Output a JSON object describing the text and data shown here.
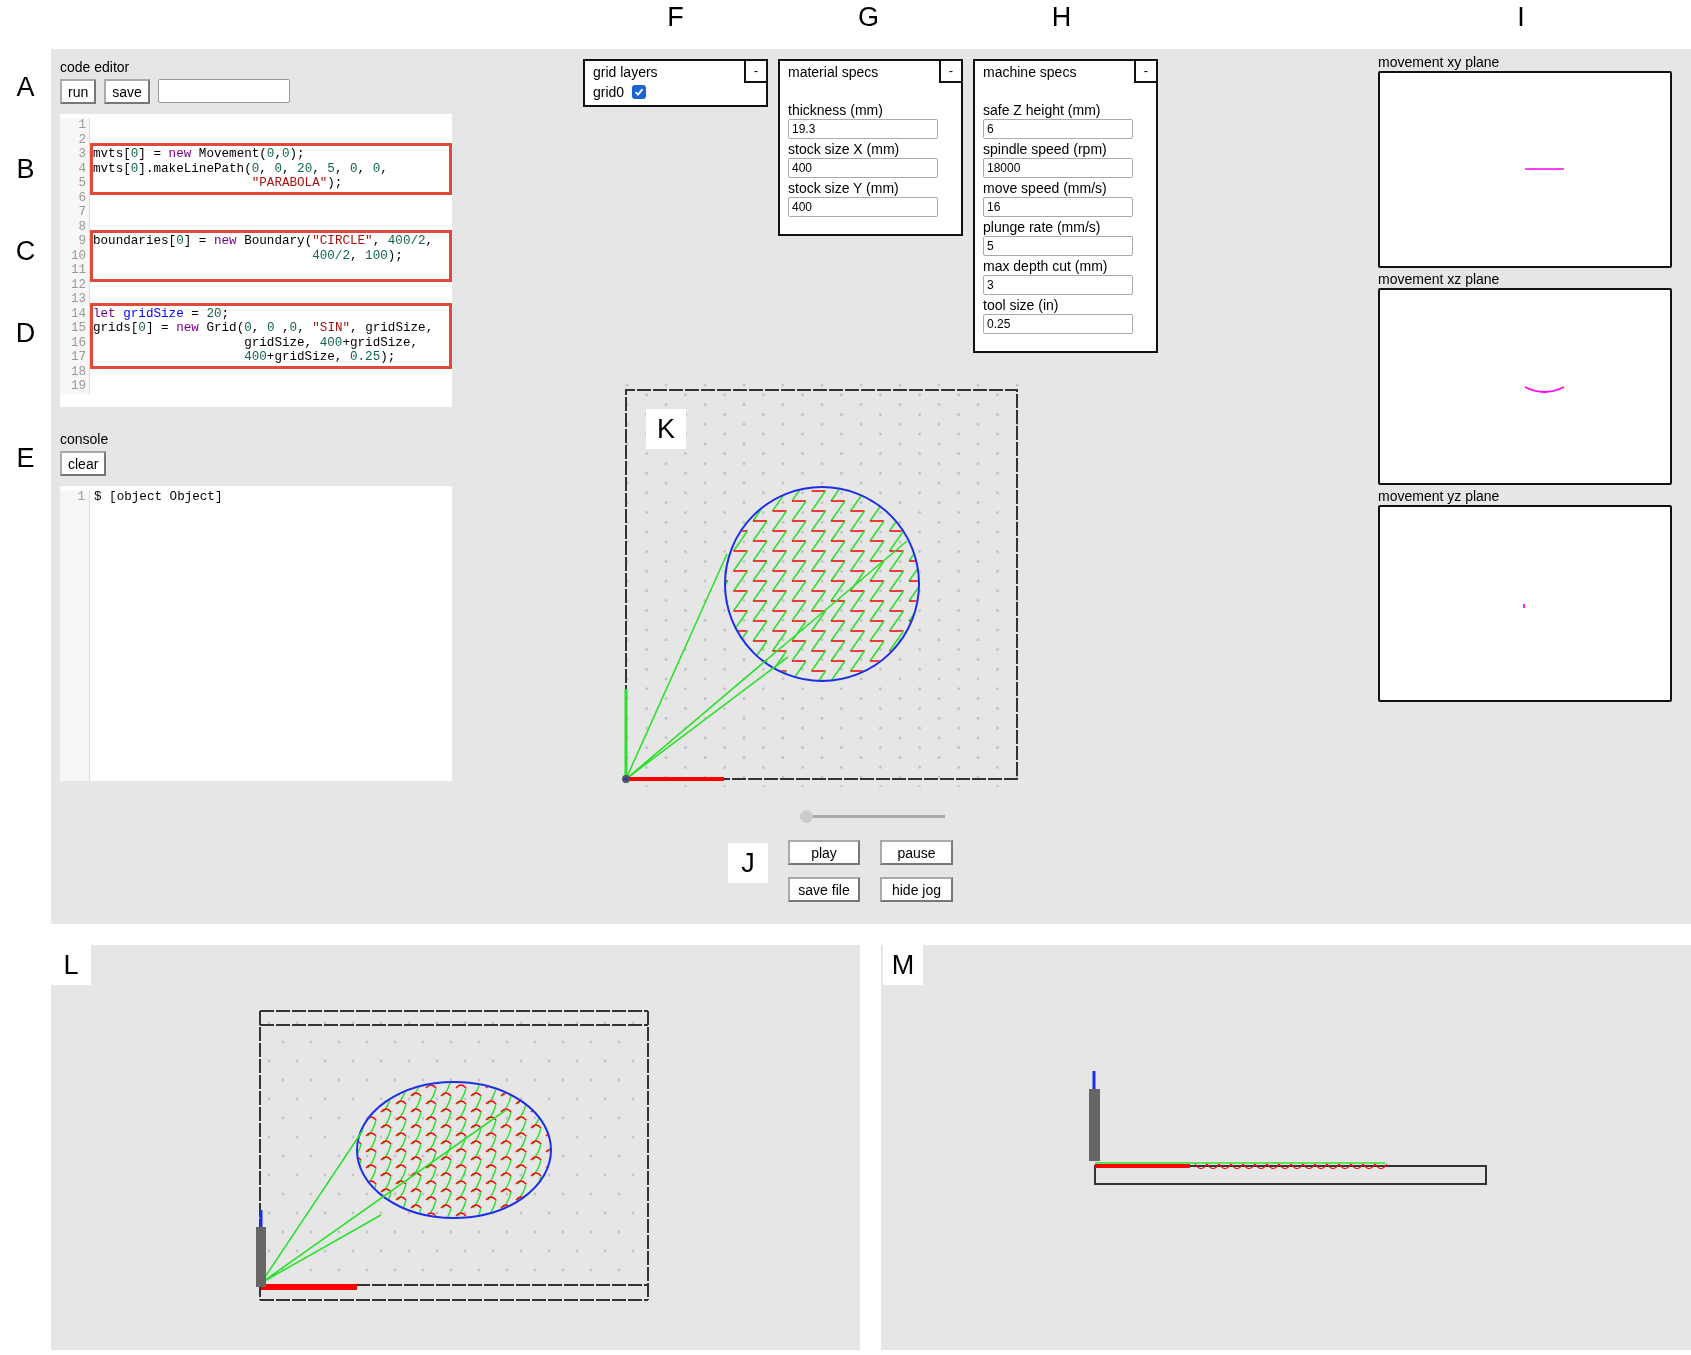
{
  "code_editor": {
    "marker": "A",
    "title": "code editor",
    "buttons": [
      "run",
      "save"
    ],
    "segments": [
      {
        "kind": "plain",
        "lines": [
          {
            "number": "1"
          },
          {
            "number": "2"
          }
        ]
      },
      {
        "kind": "highlight",
        "marker": "B",
        "lines": [
          {
            "number": "3",
            "tokens": [
              {
                "text": "mvts[",
                "kind": "plain"
              },
              {
                "text": "0",
                "kind": "number"
              },
              {
                "text": "] = ",
                "kind": "plain"
              },
              {
                "text": "new",
                "kind": "keyword"
              },
              {
                "text": " Movement(",
                "kind": "plain"
              },
              {
                "text": "0",
                "kind": "number"
              },
              {
                "text": ",",
                "kind": "plain"
              },
              {
                "text": "0",
                "kind": "number"
              },
              {
                "text": ");",
                "kind": "plain"
              }
            ]
          },
          {
            "number": "4",
            "tokens": [
              {
                "text": "mvts[",
                "kind": "plain"
              },
              {
                "text": "0",
                "kind": "number"
              },
              {
                "text": "].makeLinePath(",
                "kind": "plain"
              },
              {
                "text": "0",
                "kind": "number"
              },
              {
                "text": ", ",
                "kind": "plain"
              },
              {
                "text": "0",
                "kind": "number"
              },
              {
                "text": ", ",
                "kind": "plain"
              },
              {
                "text": "20",
                "kind": "number"
              },
              {
                "text": ", ",
                "kind": "plain"
              },
              {
                "text": "5",
                "kind": "number"
              },
              {
                "text": ", ",
                "kind": "plain"
              },
              {
                "text": "0",
                "kind": "number"
              },
              {
                "text": ", ",
                "kind": "plain"
              },
              {
                "text": "0",
                "kind": "number"
              },
              {
                "text": ",",
                "kind": "plain"
              }
            ]
          },
          {
            "number": "5",
            "tokens": [
              {
                "text": "                     \"PARABOLA\"",
                "kind": "string"
              },
              {
                "text": ");",
                "kind": "plain"
              }
            ]
          }
        ]
      },
      {
        "kind": "plain",
        "lines": [
          {
            "number": "6"
          },
          {
            "number": "7"
          },
          {
            "number": "8"
          }
        ]
      },
      {
        "kind": "highlight",
        "marker": "C",
        "lines": [
          {
            "number": "9",
            "tokens": [
              {
                "text": "boundaries[",
                "kind": "plain"
              },
              {
                "text": "0",
                "kind": "number"
              },
              {
                "text": "] = ",
                "kind": "plain"
              },
              {
                "text": "new",
                "kind": "keyword"
              },
              {
                "text": " Boundary(",
                "kind": "plain"
              },
              {
                "text": "\"CIRCLE\"",
                "kind": "string"
              },
              {
                "text": ", ",
                "kind": "plain"
              },
              {
                "text": "400/2",
                "kind": "number"
              },
              {
                "text": ",",
                "kind": "plain"
              }
            ]
          },
          {
            "number": "10",
            "tokens": [
              {
                "text": "                             400/2",
                "kind": "number"
              },
              {
                "text": ", ",
                "kind": "plain"
              },
              {
                "text": "100",
                "kind": "number"
              },
              {
                "text": ");",
                "kind": "plain"
              }
            ]
          },
          {
            "number": "11"
          }
        ]
      },
      {
        "kind": "plain",
        "lines": [
          {
            "number": "12"
          },
          {
            "number": "13"
          }
        ]
      },
      {
        "kind": "highlight",
        "marker": "D",
        "lines": [
          {
            "number": "14",
            "tokens": [
              {
                "text": "let",
                "kind": "keyword"
              },
              {
                "text": " gridSize",
                "kind": "def"
              },
              {
                "text": " = ",
                "kind": "plain"
              },
              {
                "text": "20",
                "kind": "number"
              },
              {
                "text": ";",
                "kind": "plain"
              }
            ]
          },
          {
            "number": "15",
            "tokens": [
              {
                "text": "grids[",
                "kind": "plain"
              },
              {
                "text": "0",
                "kind": "number"
              },
              {
                "text": "] = ",
                "kind": "plain"
              },
              {
                "text": "new",
                "kind": "keyword"
              },
              {
                "text": " Grid(",
                "kind": "plain"
              },
              {
                "text": "0",
                "kind": "number"
              },
              {
                "text": ", ",
                "kind": "plain"
              },
              {
                "text": "0",
                "kind": "number"
              },
              {
                "text": " ,",
                "kind": "plain"
              },
              {
                "text": "0",
                "kind": "number"
              },
              {
                "text": ", ",
                "kind": "plain"
              },
              {
                "text": "\"SIN\"",
                "kind": "string"
              },
              {
                "text": ", gridSize,",
                "kind": "plain"
              }
            ]
          },
          {
            "number": "16",
            "tokens": [
              {
                "text": "                    gridSize, ",
                "kind": "plain"
              },
              {
                "text": "400",
                "kind": "number"
              },
              {
                "text": "+gridSize,",
                "kind": "plain"
              }
            ]
          },
          {
            "number": "17",
            "tokens": [
              {
                "text": "                    400",
                "kind": "number"
              },
              {
                "text": "+gridSize, ",
                "kind": "plain"
              },
              {
                "text": "0.25",
                "kind": "number"
              },
              {
                "text": ");",
                "kind": "plain"
              }
            ]
          }
        ]
      },
      {
        "kind": "plain",
        "lines": [
          {
            "number": "18"
          },
          {
            "number": "19"
          }
        ]
      }
    ]
  },
  "console": {
    "marker": "E",
    "title": "console",
    "buttons": [
      "clear"
    ],
    "lines": [
      {
        "number": "1",
        "text": "$ [object Object]"
      }
    ]
  },
  "grid_layers": {
    "marker": "F",
    "title": "grid layers",
    "collapse_button": "-",
    "layers": [
      {
        "label": "grid0",
        "checked": true
      }
    ]
  },
  "material_specs": {
    "marker": "G",
    "title": "material specs",
    "collapse_button": "-",
    "fields": [
      {
        "label": "thickness (mm)",
        "value": "19.3"
      },
      {
        "label": "stock size X (mm)",
        "value": "400"
      },
      {
        "label": "stock size Y (mm)",
        "value": "400"
      }
    ]
  },
  "machine_specs": {
    "marker": "H",
    "title": "machine specs",
    "collapse_button": "-",
    "fields": [
      {
        "label": "safe Z height (mm)",
        "value": "6"
      },
      {
        "label": "spindle speed (rpm)",
        "value": "18000"
      },
      {
        "label": "move speed (mm/s)",
        "value": "16"
      },
      {
        "label": "plunge rate (mm/s)",
        "value": "5"
      },
      {
        "label": "max depth cut (mm)",
        "value": "3"
      },
      {
        "label": "tool size (in)",
        "value": "0.25"
      }
    ]
  },
  "preview": {
    "marker": "K"
  },
  "playback": {
    "marker": "J",
    "slider": {
      "level": 0
    },
    "buttons": [
      "play",
      "pause",
      "save file",
      "hide jog"
    ]
  },
  "movement_planes": {
    "marker": "I",
    "planes": [
      {
        "title": "movement xy plane",
        "kind": "line"
      },
      {
        "title": "movement xz plane",
        "kind": "arc"
      },
      {
        "title": "movement yz plane",
        "kind": "dot"
      }
    ]
  },
  "perspective_view": {
    "marker": "L"
  },
  "side_view": {
    "marker": "M"
  }
}
